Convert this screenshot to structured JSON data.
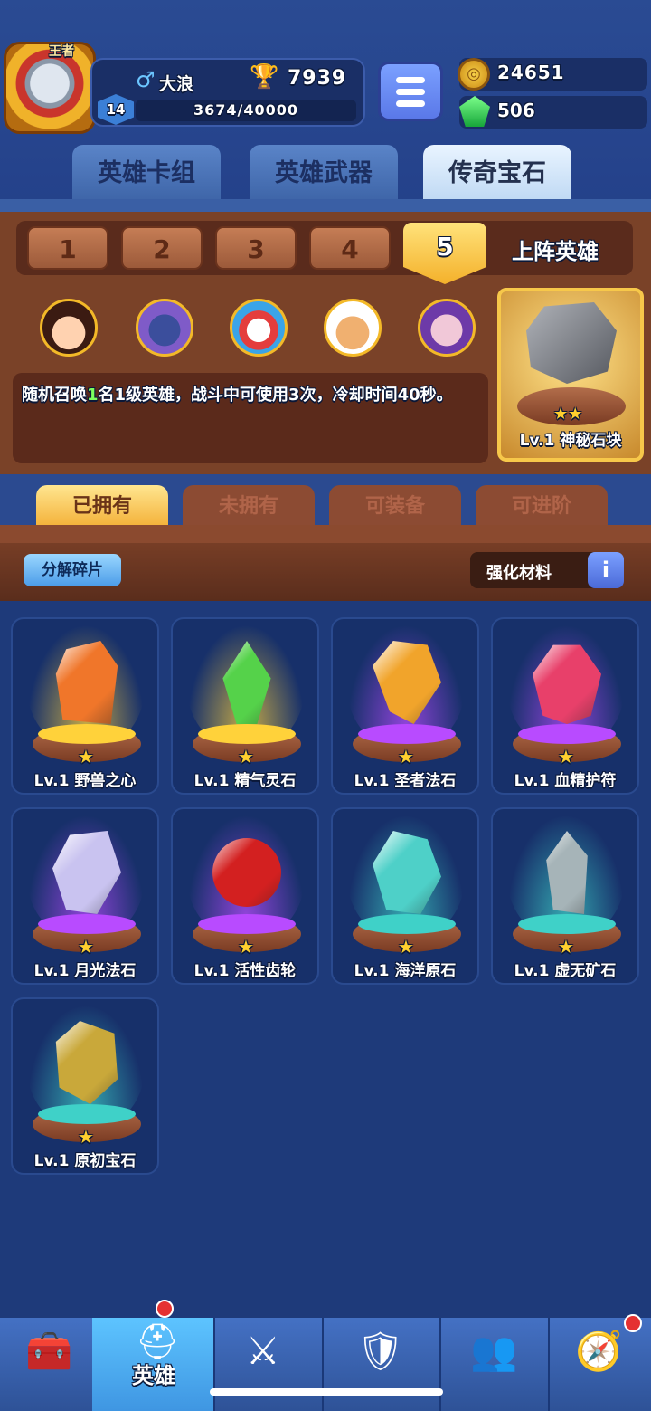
{
  "header": {
    "avatar_badge": "王者",
    "gender_icon": "male-symbol",
    "player_name": "大浪",
    "trophies": "7939",
    "level": "14",
    "xp": "3674/40000",
    "gold": "24651",
    "gems": "506"
  },
  "top_tabs": [
    {
      "label": "英雄卡组"
    },
    {
      "label": "英雄武器"
    },
    {
      "label": "传奇宝石"
    }
  ],
  "slots": [
    "1",
    "2",
    "3",
    "4",
    "5"
  ],
  "deploy_label": "上阵英雄",
  "description": {
    "before": "随机召唤",
    "highlight": "1",
    "after": "名1级英雄，战斗中可使用3次，冷却时间40秒。"
  },
  "featured_gem": {
    "name": "Lv.1 神秘石块",
    "stars": "★★"
  },
  "filter_tabs": [
    "已拥有",
    "未拥有",
    "可装备",
    "可进阶"
  ],
  "toolbar": {
    "decompose": "分解碎片",
    "enhance": "强化材料",
    "info": "i"
  },
  "gems": [
    {
      "name": "Lv.1 野兽之心",
      "star": "★",
      "color": "#f0762a",
      "glow": "#ffd23a"
    },
    {
      "name": "Lv.1 精气灵石",
      "star": "★",
      "color": "#55d24a",
      "glow": "#ffd23a"
    },
    {
      "name": "Lv.1 圣者法石",
      "star": "★",
      "color": "#f1a42b",
      "glow": "#b84bff"
    },
    {
      "name": "Lv.1 血精护符",
      "star": "★",
      "color": "#e8406a",
      "glow": "#b84bff"
    },
    {
      "name": "Lv.1 月光法石",
      "star": "★",
      "color": "#c9c3f0",
      "glow": "#b84bff"
    },
    {
      "name": "Lv.1 活性齿轮",
      "star": "★",
      "color": "#d32020",
      "glow": "#b84bff"
    },
    {
      "name": "Lv.1 海洋原石",
      "star": "★",
      "color": "#4ed0c8",
      "glow": "#3fd1c8"
    },
    {
      "name": "Lv.1 虚无矿石",
      "star": "★",
      "color": "#a6b4b8",
      "glow": "#3fd1c8"
    },
    {
      "name": "Lv.1 原初宝石",
      "star": "★",
      "color": "#c9a83a",
      "glow": "#3fd1c8"
    }
  ],
  "nav": {
    "hero_label": "英雄"
  }
}
